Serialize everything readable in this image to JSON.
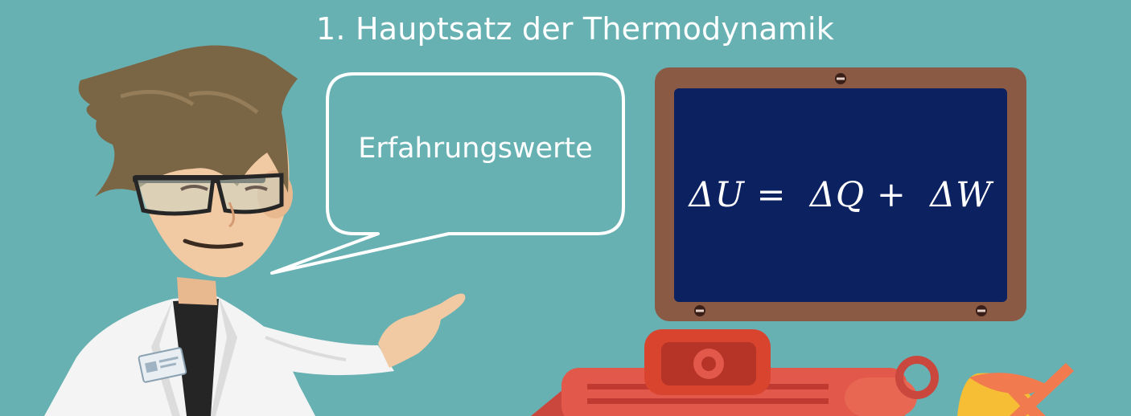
{
  "title": "1. Hauptsatz der Thermodynamik",
  "speech_bubble": {
    "text": "Erfahrungswerte"
  },
  "chalkboard": {
    "formula": "ΔU =  ΔQ +  ΔW"
  },
  "colors": {
    "background": "#68b1b3",
    "board": "#0c2160",
    "frame": "#8b5a45",
    "hair": "#7a6545",
    "coat": "#f4f4f4",
    "skin": "#f1c9a2",
    "machine": "#e2584a",
    "accent_yellow": "#f5be34"
  },
  "icons": {
    "character": "scientist-character",
    "machine": "steam-engine-illustration"
  }
}
